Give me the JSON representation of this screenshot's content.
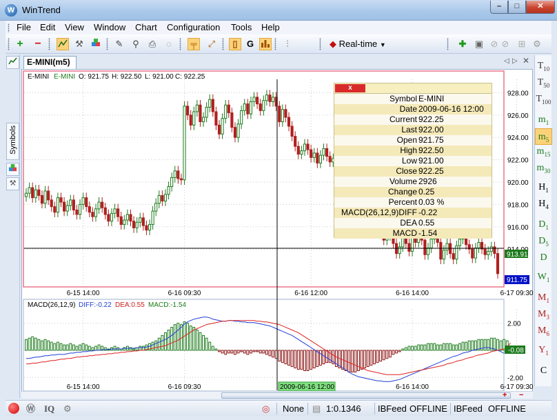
{
  "window": {
    "title": "WinTrend",
    "app_icon": "W",
    "min_label": "–",
    "max_label": "□",
    "close_label": "✕"
  },
  "menu": [
    "File",
    "Edit",
    "View",
    "Window",
    "Chart",
    "Configuration",
    "Tools",
    "Help"
  ],
  "toolbar": {
    "mode_label": "Real-time",
    "mode_arrow": "▼"
  },
  "left_dock": {
    "symbols_tab": "Symbols"
  },
  "chart_tab": {
    "label": "E-MINI(m5)"
  },
  "price_header": {
    "symbol1": "E-MINI",
    "symbol2": "E-MINI",
    "open": "O: 921.75",
    "high": "H: 922.50",
    "low": "L: 921.00",
    "close": "C: 922.25"
  },
  "macd_header": {
    "name": "MACD(26,12,9)",
    "diff": "DIFF:-0.22",
    "dea": "DEA:0.55",
    "macd": "MACD:-1.54"
  },
  "colors": {
    "up": "#1c7a1c",
    "down": "#b02020",
    "diff_line": "#1f3fd6",
    "dea_line": "#e02020",
    "panel_border": "#e8748c",
    "crosshair": "#000000"
  },
  "info_panel": {
    "close_label": "x",
    "rows": [
      {
        "label": "Symbol",
        "value": "E-MINI"
      },
      {
        "label": "Date",
        "value": "2009-06-16 12:00"
      },
      {
        "label": "Current",
        "value": "922.25"
      },
      {
        "label": "Last",
        "value": "922.00"
      },
      {
        "label": "Open",
        "value": "921.75"
      },
      {
        "label": "High",
        "value": "922.50"
      },
      {
        "label": "Low",
        "value": "921.00"
      },
      {
        "label": "Close",
        "value": "922.25"
      },
      {
        "label": "Volume",
        "value": "2926"
      },
      {
        "label": "Change",
        "value": "0.25"
      },
      {
        "label": "Percent",
        "value": "0.03 %"
      },
      {
        "label": "MACD(26,12,9)DIFF",
        "value": "-0.22"
      },
      {
        "label": "DEA",
        "value": "0.55"
      },
      {
        "label": "MACD",
        "value": "-1.54"
      }
    ]
  },
  "timeframes": [
    {
      "main": "T",
      "sub": "10"
    },
    {
      "main": "T",
      "sub": "50"
    },
    {
      "main": "T",
      "sub": "100"
    },
    {
      "main": "m",
      "sub": "1"
    },
    {
      "main": "m",
      "sub": "5"
    },
    {
      "main": "m",
      "sub": "15"
    },
    {
      "main": "m",
      "sub": "30"
    },
    {
      "main": "H",
      "sub": "1"
    },
    {
      "main": "H",
      "sub": "4"
    },
    {
      "main": "D",
      "sub": "1"
    },
    {
      "main": "D",
      "sub": "5"
    },
    {
      "main": "D",
      "sub": ""
    },
    {
      "main": "W",
      "sub": "1"
    },
    {
      "main": "M",
      "sub": "1"
    },
    {
      "main": "M",
      "sub": "3"
    },
    {
      "main": "M",
      "sub": "6"
    },
    {
      "main": "Y",
      "sub": "1"
    },
    {
      "main": "C",
      "sub": ""
    }
  ],
  "selected_timeframe": "m5",
  "status": {
    "none": "None",
    "scale": "1:0.1346",
    "feed1": "IBFeed",
    "state1": "OFFLINE",
    "feed2": "IBFeed",
    "state2": "OFFLINE",
    "iq": "IQ"
  },
  "crosshair": {
    "price_label": "913.91",
    "last_price_label": "911.75",
    "date_label": "2009-06-16 12:00"
  },
  "chart_data": [
    {
      "type": "candlestick",
      "title": "E-MINI(m5)",
      "ylim": [
        910.8,
        929.2
      ],
      "yticks": [
        914,
        916,
        918,
        920,
        922,
        924,
        926,
        928
      ],
      "ytick_labels": [
        "914.00",
        "916.00",
        "918.00",
        "920.00",
        "922.00",
        "924.00",
        "926.00",
        "928.00"
      ],
      "xticks": [
        {
          "index": 18,
          "label": "6-15 14:00"
        },
        {
          "index": 50,
          "label": "6-16 09:30"
        },
        {
          "index": 90,
          "label": "6-16 12:00"
        },
        {
          "index": 122,
          "label": "6-16 14:00"
        },
        {
          "index": 155,
          "label": "6-17 09:30"
        }
      ],
      "closes": [
        919.0,
        919.5,
        918.6,
        919.3,
        918.8,
        918.1,
        919.2,
        918.4,
        917.8,
        917.3,
        918.6,
        918.2,
        917.4,
        917.9,
        918.4,
        917.5,
        917.1,
        918.0,
        918.6,
        917.8,
        917.3,
        916.9,
        917.6,
        918.2,
        917.7,
        917.1,
        916.5,
        917.2,
        917.6,
        916.9,
        916.2,
        916.6,
        917.1,
        916.5,
        915.9,
        916.4,
        916.8,
        916.1,
        915.7,
        916.2,
        917.4,
        918.1,
        918.8,
        918.3,
        918.9,
        919.6,
        920.4,
        921.0,
        920.3,
        920.2,
        926.8,
        926.0,
        925.1,
        926.3,
        926.9,
        925.4,
        925.8,
        926.7,
        927.4,
        926.3,
        925.1,
        924.3,
        925.7,
        926.9,
        926.2,
        924.9,
        924.0,
        925.2,
        926.4,
        927.0,
        926.1,
        927.2,
        927.6,
        927.0,
        926.4,
        927.3,
        927.8,
        927.2,
        927.6,
        926.8,
        925.4,
        926.5,
        925.8,
        925.0,
        924.1,
        923.2,
        922.5,
        922.8,
        923.4,
        922.9,
        922.2,
        922.6,
        921.7,
        922.4,
        923.0,
        922.3,
        921.8,
        922.1,
        920.1,
        919.4,
        918.5,
        917.9,
        917.0,
        916.2,
        915.5,
        915.9,
        916.7,
        916.1,
        915.4,
        916.3,
        917.1,
        916.5,
        915.6,
        914.8,
        915.2,
        915.8,
        914.5,
        913.6,
        914.2,
        915.0,
        914.5,
        913.8,
        915.2,
        914.6,
        915.4,
        914.8,
        913.5,
        914.1,
        914.9,
        915.4,
        914.6,
        913.1,
        913.9,
        914.5,
        913.6,
        913.1,
        914.3,
        914.9,
        915.3,
        914.4,
        914.0,
        913.2,
        914.1,
        914.6,
        914.0,
        913.5,
        913.8,
        914.2,
        913.6,
        911.8
      ]
    },
    {
      "type": "bar+line",
      "title": "MACD(26,12,9)",
      "ylim": [
        -2.8,
        3.0
      ],
      "yticks": [
        2.0,
        0.0,
        -2.0
      ],
      "ytick_labels": [
        "2.00",
        "0.00",
        "-2.00"
      ],
      "current_macd_label": "-0.08",
      "xticks": [
        {
          "index": 18,
          "label": "6-15 14:00"
        },
        {
          "index": 50,
          "label": "6-16 09:30"
        },
        {
          "index": 90,
          "label": "6-16 12:00"
        },
        {
          "index": 122,
          "label": "6-16 14:00"
        },
        {
          "index": 155,
          "label": "6-17 09:30"
        }
      ],
      "series": [
        {
          "name": "MACD",
          "values": [
            0.8,
            0.9,
            1.0,
            0.9,
            0.8,
            0.7,
            0.8,
            0.7,
            0.6,
            0.5,
            0.6,
            0.5,
            0.4,
            0.4,
            0.5,
            0.4,
            0.3,
            0.4,
            0.5,
            0.4,
            0.3,
            0.2,
            0.3,
            0.4,
            0.3,
            0.2,
            0.1,
            0.2,
            0.3,
            0.2,
            0.1,
            0.2,
            0.3,
            0.2,
            0.1,
            0.2,
            0.3,
            0.3,
            0.4,
            0.5,
            0.6,
            0.7,
            0.9,
            1.1,
            1.3,
            1.5,
            1.7,
            1.9,
            2.0,
            1.9,
            2.1,
            2.0,
            1.8,
            1.7,
            1.5,
            1.3,
            1.1,
            0.9,
            0.6,
            0.3,
            0.1,
            -0.1,
            -0.2,
            -0.3,
            -0.2,
            -0.2,
            -0.3,
            -0.2,
            -0.1,
            -0.2,
            -0.3,
            -0.2,
            -0.1,
            -0.1,
            -0.2,
            -0.2,
            -0.3,
            -0.4,
            -0.5,
            -0.6,
            -0.8,
            -0.9,
            -1.0,
            -1.1,
            -1.2,
            -1.3,
            -1.4,
            -1.4,
            -1.5,
            -1.5,
            -1.4,
            -1.3,
            -1.2,
            -1.1,
            -1.0,
            -0.9,
            -0.9,
            -1.0,
            -1.2,
            -1.3,
            -1.4,
            -1.5,
            -1.6,
            -1.6,
            -1.6,
            -1.5,
            -1.4,
            -1.3,
            -1.2,
            -1.1,
            -1.0,
            -0.9,
            -0.8,
            -0.7,
            -0.6,
            -0.5,
            -0.3,
            -0.2,
            -0.1,
            0.1,
            0.2,
            0.3,
            0.3,
            0.3,
            0.4,
            0.4,
            0.4,
            0.5,
            0.5,
            0.5,
            0.4,
            0.4,
            0.5,
            0.5,
            0.5,
            0.4,
            0.4,
            0.5,
            0.6,
            0.6,
            0.7,
            0.7,
            0.7,
            0.8,
            0.8,
            0.8,
            0.8,
            0.9,
            0.9,
            0.8,
            0.7,
            0.8,
            0.7,
            -0.1
          ]
        },
        {
          "name": "DIFF",
          "values": [
            -0.6,
            -0.6,
            -0.55,
            -0.5,
            -0.5,
            -0.45,
            -0.4,
            -0.4,
            -0.35,
            -0.35,
            -0.3,
            -0.3,
            -0.3,
            -0.25,
            -0.2,
            -0.2,
            -0.15,
            -0.15,
            -0.1,
            -0.1,
            -0.05,
            -0.05,
            0.0,
            0.0,
            0.05,
            0.05,
            0.05,
            0.1,
            0.1,
            0.1,
            0.1,
            0.15,
            0.15,
            0.15,
            0.15,
            0.2,
            0.2,
            0.2,
            0.25,
            0.3,
            0.4,
            0.5,
            0.6,
            0.7,
            0.8,
            0.95,
            1.1,
            1.3,
            1.5,
            1.7,
            1.95,
            2.1,
            2.2,
            2.3,
            2.35,
            2.4,
            2.45,
            2.45,
            2.4,
            2.3,
            2.25,
            2.2,
            2.15,
            2.15,
            2.2,
            2.2,
            2.15,
            2.15,
            2.1,
            2.1,
            2.05,
            2.05,
            2.05,
            2.0,
            1.95,
            1.9,
            1.85,
            1.8,
            1.7,
            1.6,
            1.5,
            1.4,
            1.3,
            1.2,
            1.1,
            0.95,
            0.8,
            0.65,
            0.5,
            0.35,
            0.2,
            0.05,
            -0.1,
            -0.25,
            -0.4,
            -0.55,
            -0.7,
            -0.85,
            -1.0,
            -1.15,
            -1.3,
            -1.45,
            -1.6,
            -1.75,
            -1.85,
            -1.95,
            -2.0,
            -2.05,
            -2.1,
            -2.15,
            -2.2,
            -2.25,
            -2.25,
            -2.3,
            -2.3,
            -2.3,
            -2.25,
            -2.2,
            -2.15,
            -2.05,
            -1.95,
            -1.85,
            -1.75,
            -1.65,
            -1.55,
            -1.45,
            -1.35,
            -1.25,
            -1.15,
            -1.05,
            -0.95,
            -0.85,
            -0.75,
            -0.65,
            -0.55,
            -0.45,
            -0.4,
            -0.3,
            -0.2,
            -0.15,
            -0.1,
            0.0,
            0.05,
            0.1,
            0.15,
            0.2,
            0.2,
            0.15,
            0.1,
            0.0,
            -0.1,
            -0.22
          ]
        },
        {
          "name": "DEA",
          "values": [
            -1.0,
            -1.0,
            -0.95,
            -0.95,
            -0.9,
            -0.85,
            -0.85,
            -0.8,
            -0.75,
            -0.75,
            -0.7,
            -0.65,
            -0.65,
            -0.6,
            -0.6,
            -0.55,
            -0.5,
            -0.5,
            -0.45,
            -0.45,
            -0.4,
            -0.4,
            -0.35,
            -0.35,
            -0.3,
            -0.3,
            -0.25,
            -0.25,
            -0.2,
            -0.2,
            -0.15,
            -0.15,
            -0.1,
            -0.1,
            -0.05,
            -0.05,
            0.0,
            0.0,
            0.05,
            0.1,
            0.15,
            0.2,
            0.25,
            0.3,
            0.35,
            0.45,
            0.55,
            0.65,
            0.75,
            0.9,
            1.05,
            1.2,
            1.35,
            1.5,
            1.6,
            1.7,
            1.8,
            1.9,
            1.95,
            2.0,
            2.05,
            2.1,
            2.15,
            2.15,
            2.2,
            2.2,
            2.2,
            2.2,
            2.2,
            2.2,
            2.2,
            2.2,
            2.2,
            2.15,
            2.15,
            2.1,
            2.1,
            2.05,
            2.0,
            1.95,
            1.9,
            1.8,
            1.7,
            1.6,
            1.5,
            1.4,
            1.3,
            1.15,
            1.0,
            0.85,
            0.7,
            0.55,
            0.4,
            0.25,
            0.1,
            -0.05,
            -0.2,
            -0.35,
            -0.5,
            -0.6,
            -0.7,
            -0.8,
            -0.9,
            -1.0,
            -1.1,
            -1.2,
            -1.3,
            -1.4,
            -1.5,
            -1.55,
            -1.6,
            -1.65,
            -1.7,
            -1.75,
            -1.8,
            -1.8,
            -1.8,
            -1.8,
            -1.8,
            -1.75,
            -1.7,
            -1.65,
            -1.6,
            -1.55,
            -1.5,
            -1.45,
            -1.4,
            -1.35,
            -1.3,
            -1.25,
            -1.2,
            -1.15,
            -1.1,
            -1.0,
            -0.95,
            -0.9,
            -0.8,
            -0.75,
            -0.7,
            -0.6,
            -0.55,
            -0.5,
            -0.4,
            -0.35,
            -0.3,
            -0.25,
            -0.2,
            -0.1,
            -0.05,
            0.0,
            0.05,
            0.1,
            0.2,
            0.55
          ]
        }
      ]
    }
  ]
}
